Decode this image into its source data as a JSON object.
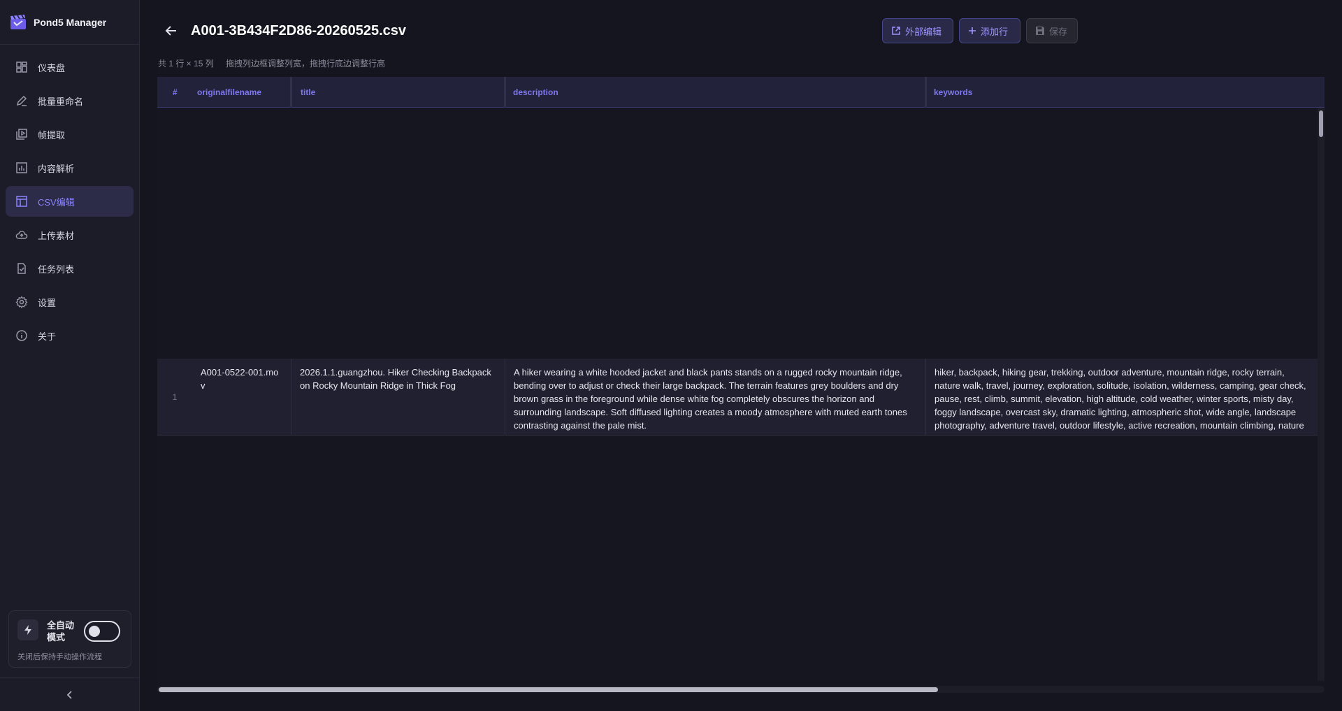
{
  "app": {
    "name": "Pond5 Manager"
  },
  "sidebar": {
    "items": [
      {
        "label": "仪表盘",
        "icon": "dashboard-icon"
      },
      {
        "label": "批量重命名",
        "icon": "pen-icon"
      },
      {
        "label": "帧提取",
        "icon": "video-frames-icon"
      },
      {
        "label": "内容解析",
        "icon": "chart-icon"
      },
      {
        "label": "CSV编辑",
        "icon": "table-icon",
        "active": true
      },
      {
        "label": "上传素材",
        "icon": "cloud-upload-icon"
      },
      {
        "label": "任务列表",
        "icon": "task-file-icon"
      },
      {
        "label": "设置",
        "icon": "gear-icon"
      },
      {
        "label": "关于",
        "icon": "info-icon"
      }
    ],
    "auto_mode": {
      "label": "全自动模式",
      "hint": "关闭后保持手动操作流程",
      "enabled": false
    }
  },
  "header": {
    "file_title": "A001-3B434F2D86-20260525.csv",
    "external_edit": "外部编辑",
    "add_row": "添加行",
    "save": "保存"
  },
  "meta": {
    "summary": "共 1 行 × 15 列",
    "hint": "拖拽列边框调整列宽，拖拽行底边调整行高"
  },
  "table": {
    "columns": [
      "#",
      "originalfilename",
      "title",
      "description",
      "keywords"
    ],
    "rows": [
      {
        "num": "1",
        "originalfilename": "A001-0522-001.mov",
        "title": "2026.1.1.guangzhou. Hiker Checking Backpack on Rocky Mountain Ridge in Thick Fog",
        "description": "A hiker wearing a white hooded jacket and black pants stands on a rugged rocky mountain ridge, bending over to adjust or check their large backpack. The terrain features grey boulders and dry brown grass in the foreground while dense white fog completely obscures the horizon and surrounding landscape. Soft diffused lighting creates a moody atmosphere with muted earth tones contrasting against the pale mist.",
        "keywords": "hiker, backpack, hiking gear, trekking, outdoor adventure, mountain ridge, rocky terrain, nature walk, travel, journey, exploration, solitude, isolation, wilderness, camping, gear check, pause, rest, climb, summit, elevation, high altitude, cold weather, winter sports, misty day, foggy landscape, overcast sky, dramatic lighting, atmospheric shot, wide angle, landscape photography, adventure travel, outdoor lifestyle, active recreation, mountain climbing, nature"
      }
    ]
  },
  "colors": {
    "accent": "#8c83ff",
    "background": "#15151f",
    "sidebar": "#1c1c29"
  }
}
